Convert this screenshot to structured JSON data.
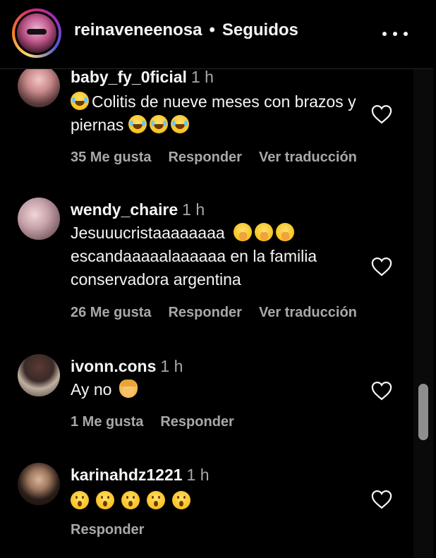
{
  "header": {
    "username": "reinaveneenosa",
    "separator": "•",
    "follow_status": "Seguidos",
    "more_icon": "more-horizontal-icon"
  },
  "comments": [
    {
      "username": "baby_fy_0ficial",
      "time": "1 h",
      "text_before": "Colitis de nueve meses con brazos y piernas",
      "emoji_lead": "face-with-tears-of-joy",
      "emoji_trail": [
        "face-with-tears-of-joy",
        "face-with-tears-of-joy",
        "face-with-tears-of-joy"
      ],
      "likes": "35 Me gusta",
      "reply": "Responder",
      "translate": "Ver traducción"
    },
    {
      "username": "wendy_chaire",
      "time": "1 h",
      "line1": "Jesuuucristaaaaaaaa",
      "line2": "escandaaaaalaaaaaa en la familia",
      "line3": "conservadora argentina",
      "emoji_trail": [
        "shushing-face",
        "shushing-face",
        "shushing-face"
      ],
      "likes": "26 Me gusta",
      "reply": "Responder",
      "translate": "Ver traducción"
    },
    {
      "username": "ivonn.cons",
      "time": "1 h",
      "text": "Ay no",
      "emoji_trail": [
        "woman-facepalming"
      ],
      "likes": "1 Me gusta",
      "reply": "Responder"
    },
    {
      "username": "karinahdz1221",
      "time": "1 h",
      "emoji_trail": [
        "face-with-open-mouth",
        "face-with-open-mouth",
        "face-with-open-mouth",
        "face-with-open-mouth",
        "face-with-open-mouth"
      ],
      "reply": "Responder"
    }
  ],
  "colors": {
    "background": "#000000",
    "text": "#f5f5f5",
    "muted": "#a8a8a8"
  }
}
